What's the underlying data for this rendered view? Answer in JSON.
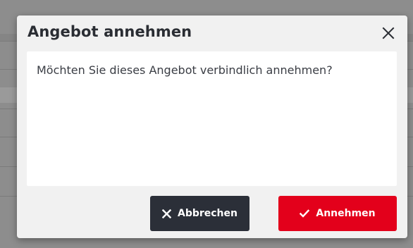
{
  "dialog": {
    "title": "Angebot annehmen",
    "message": "Möchten Sie dieses Angebot verbindlich annehmen?",
    "close_icon": "close-icon",
    "buttons": {
      "cancel_label": "Abbrechen",
      "cancel_icon": "close-icon",
      "accept_label": "Annehmen",
      "accept_icon": "checkmark-icon"
    }
  },
  "colors": {
    "accept": "#e3001b",
    "cancel": "#2b2f38",
    "overlay": "#8d8d8d"
  }
}
